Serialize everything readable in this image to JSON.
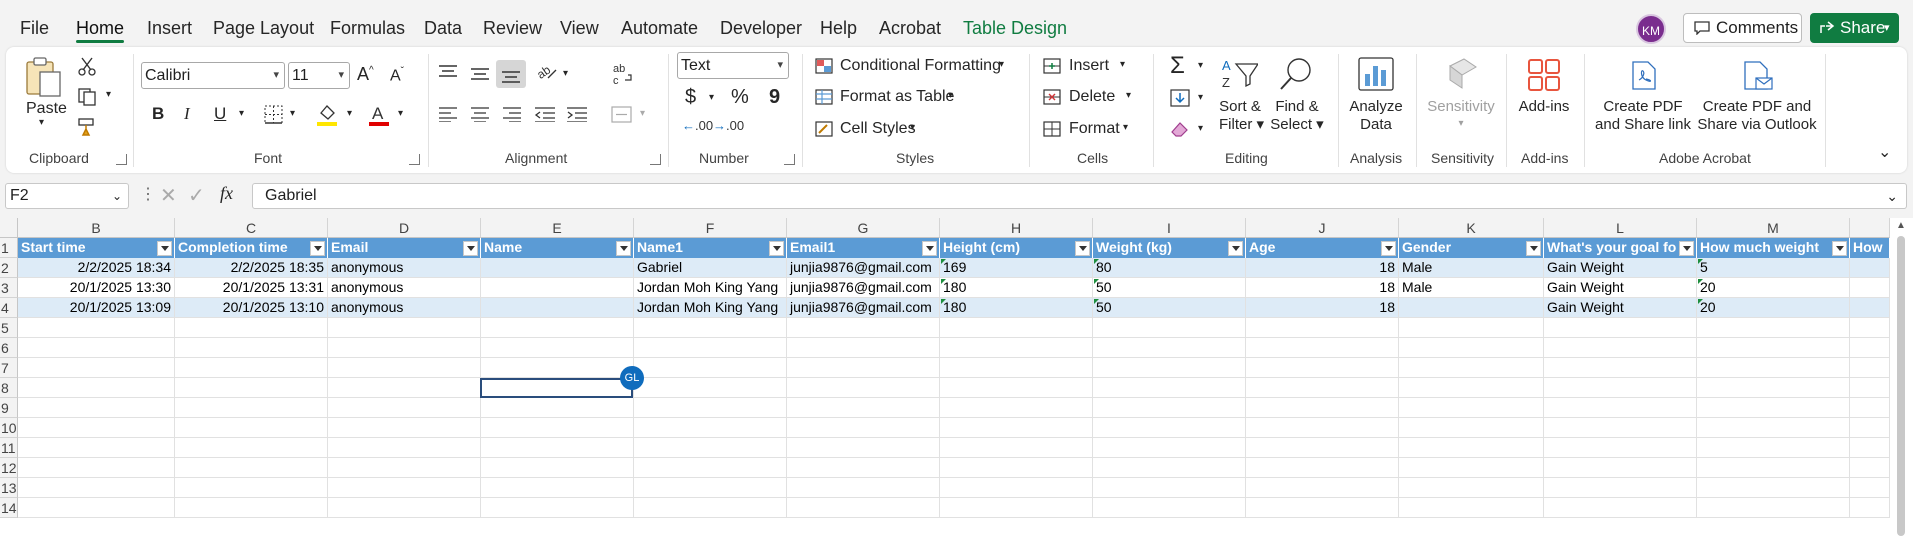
{
  "menu": {
    "tabs": [
      "File",
      "Home",
      "Insert",
      "Page Layout",
      "Formulas",
      "Data",
      "Review",
      "View",
      "Automate",
      "Developer",
      "Help",
      "Acrobat",
      "Table Design"
    ],
    "avatar_initials": "KM",
    "comments_label": "Comments",
    "share_label": "Share"
  },
  "ribbon": {
    "clipboard": {
      "paste": "Paste",
      "label": "Clipboard"
    },
    "font": {
      "name": "Calibri",
      "size": "11",
      "label": "Font"
    },
    "alignment": {
      "label": "Alignment"
    },
    "number": {
      "format": "Text",
      "currency": "$",
      "percent": "%",
      "comma": "9",
      "inc": ".00",
      "dec": ".00",
      "label": "Number"
    },
    "styles": {
      "conditional": "Conditional Formatting",
      "format_table": "Format as Table",
      "cell_styles": "Cell Styles",
      "label": "Styles"
    },
    "cells": {
      "insert": "Insert",
      "delete": "Delete",
      "format": "Format",
      "label": "Cells"
    },
    "editing": {
      "sigma": "Σ",
      "sort1": "Sort &",
      "sort2": "Filter",
      "find1": "Find &",
      "find2": "Select",
      "label": "Editing"
    },
    "analysis": {
      "btn1": "Analyze",
      "btn2": "Data",
      "label": "Analysis"
    },
    "sensitivity": {
      "btn": "Sensitivity",
      "label": "Sensitivity"
    },
    "addins": {
      "btn": "Add-ins",
      "label": "Add-ins"
    },
    "acrobat": {
      "b1l1": "Create PDF",
      "b1l2": "and Share link",
      "b2l1": "Create PDF and",
      "b2l2": "Share via Outlook",
      "label": "Adobe Acrobat"
    }
  },
  "formula_bar": {
    "cell_ref": "F2",
    "fx": "fx",
    "value": "Gabriel"
  },
  "columns": [
    "B",
    "C",
    "D",
    "E",
    "F",
    "G",
    "H",
    "I",
    "J",
    "K",
    "L",
    "M"
  ],
  "rows": [
    "1",
    "2",
    "3",
    "4",
    "5",
    "6",
    "7",
    "8",
    "9",
    "10",
    "11",
    "12",
    "13",
    "14"
  ],
  "table": {
    "headers": [
      "Start time",
      "Completion time",
      "Email",
      "Name",
      "Name1",
      "Email1",
      "Height (cm)",
      "Weight (kg)",
      "Age",
      "Gender",
      "What's your goal fo",
      "How much weight",
      "How"
    ],
    "data": [
      [
        "2/2/2025 18:34",
        "2/2/2025 18:35",
        "anonymous",
        "",
        "Gabriel",
        "junjia9876@gmail.com",
        "169",
        "80",
        "18",
        "Male",
        "Gain Weight",
        "5",
        ""
      ],
      [
        "20/1/2025 13:30",
        "20/1/2025 13:31",
        "anonymous",
        "",
        "Jordan Moh King Yang",
        "junjia9876@gmail.com",
        "180",
        "50",
        "18",
        "Male",
        "Gain Weight",
        "20",
        ""
      ],
      [
        "20/1/2025 13:09",
        "20/1/2025 13:10",
        "anonymous",
        "",
        "Jordan Moh King Yang",
        "junjia9876@gmail.com",
        "180",
        "50",
        "18",
        "",
        "Gain Weight",
        "20",
        ""
      ]
    ]
  },
  "presence": {
    "initials": "GL"
  },
  "colors": {
    "accent": "#107c41",
    "table_header": "#5b9bd5",
    "band": "#ddebf7",
    "presence": "#0f6cbd"
  }
}
